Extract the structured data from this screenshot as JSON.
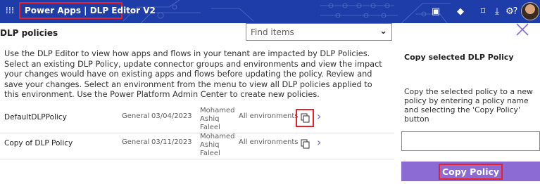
{
  "header": {
    "app_title": "Power Apps | DLP Editor V2",
    "waffle_icon": "waffle-icon",
    "icons": [
      "present-icon",
      "teams-icon",
      "desktop-icon",
      "download-icon",
      "gear-icon",
      "help-icon"
    ],
    "brand_color": "#1f3da8"
  },
  "main": {
    "title": "DLP policies",
    "search": {
      "placeholder": "Find items"
    },
    "description": "Use the DLP Editor to view how apps and flows in your tenant are impacted by DLP Policies. Select an existing DLP Policy, update connector groups and environments and view the impact your changes would have on existing apps and flows before updating the policy. Review and save your changes. Select an environment from the menu to view all DLP policies applied to this environment. Use the Power Platform Admin Center to create new policies.",
    "policies": [
      {
        "name": "DefaultDLPPolicy",
        "environment_type": "General",
        "date": "03/04/2023",
        "owner_first": "Mohamed",
        "owner_last": "Ashiq Faleel",
        "scope": "All environments",
        "highlighted": true
      },
      {
        "name": "Copy of DLP Policy",
        "environment_type": "General",
        "date": "03/11/2023",
        "owner_first": "Mohamed",
        "owner_last": "Ashiq Faleel",
        "scope": "All environments",
        "highlighted": false
      }
    ]
  },
  "panel": {
    "title": "Copy selected DLP Policy",
    "description": "Copy the selected policy to a new policy by entering a policy name and selecting the 'Copy Policy' button",
    "input_value": "",
    "button_label": "Copy Policy",
    "accent_color": "#8c6bd5",
    "highlight_color": "#e8202a"
  }
}
